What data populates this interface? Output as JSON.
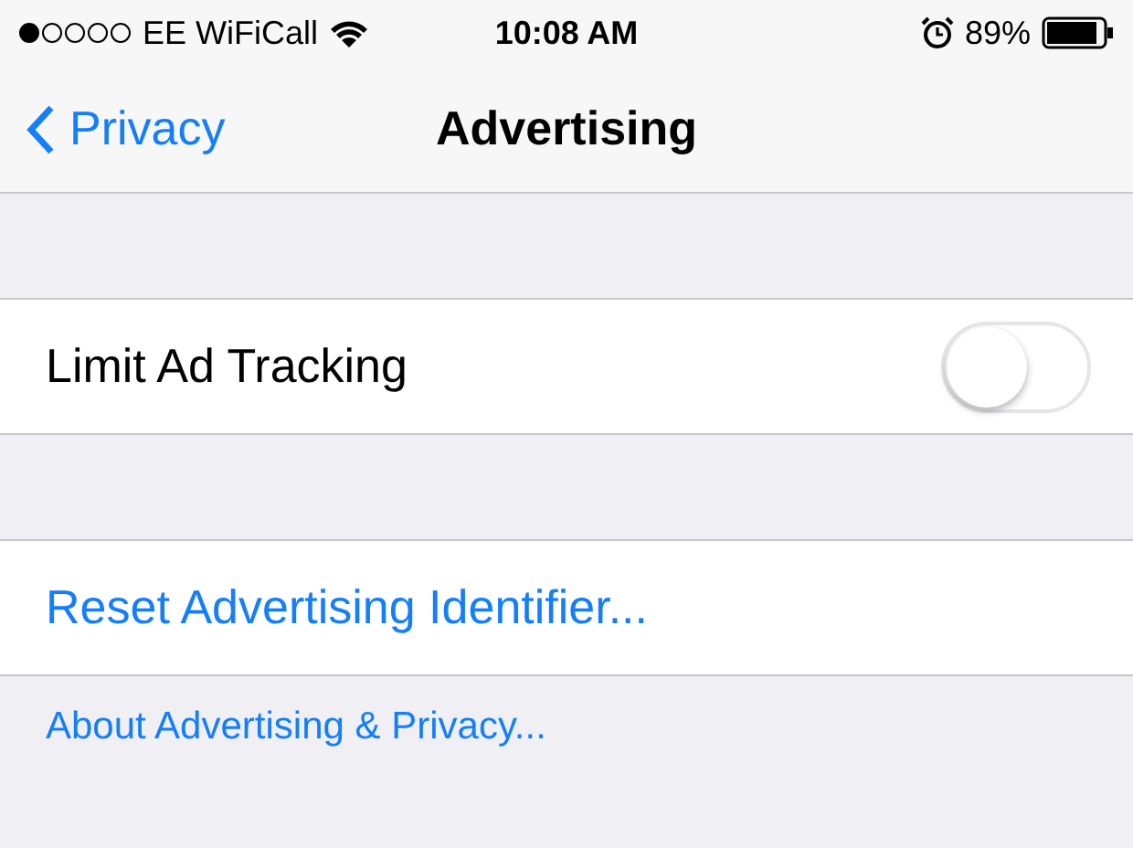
{
  "status_bar": {
    "carrier": "EE WiFiCall",
    "time": "10:08 AM",
    "battery": "89%"
  },
  "nav": {
    "back": "Privacy",
    "title": "Advertising"
  },
  "groups": [
    {
      "kind": "toggle",
      "label": "Limit Ad Tracking",
      "on": false
    },
    {
      "kind": "link",
      "label": "Reset Advertising Identifier..."
    }
  ],
  "footer_link": "About Advertising & Privacy..."
}
